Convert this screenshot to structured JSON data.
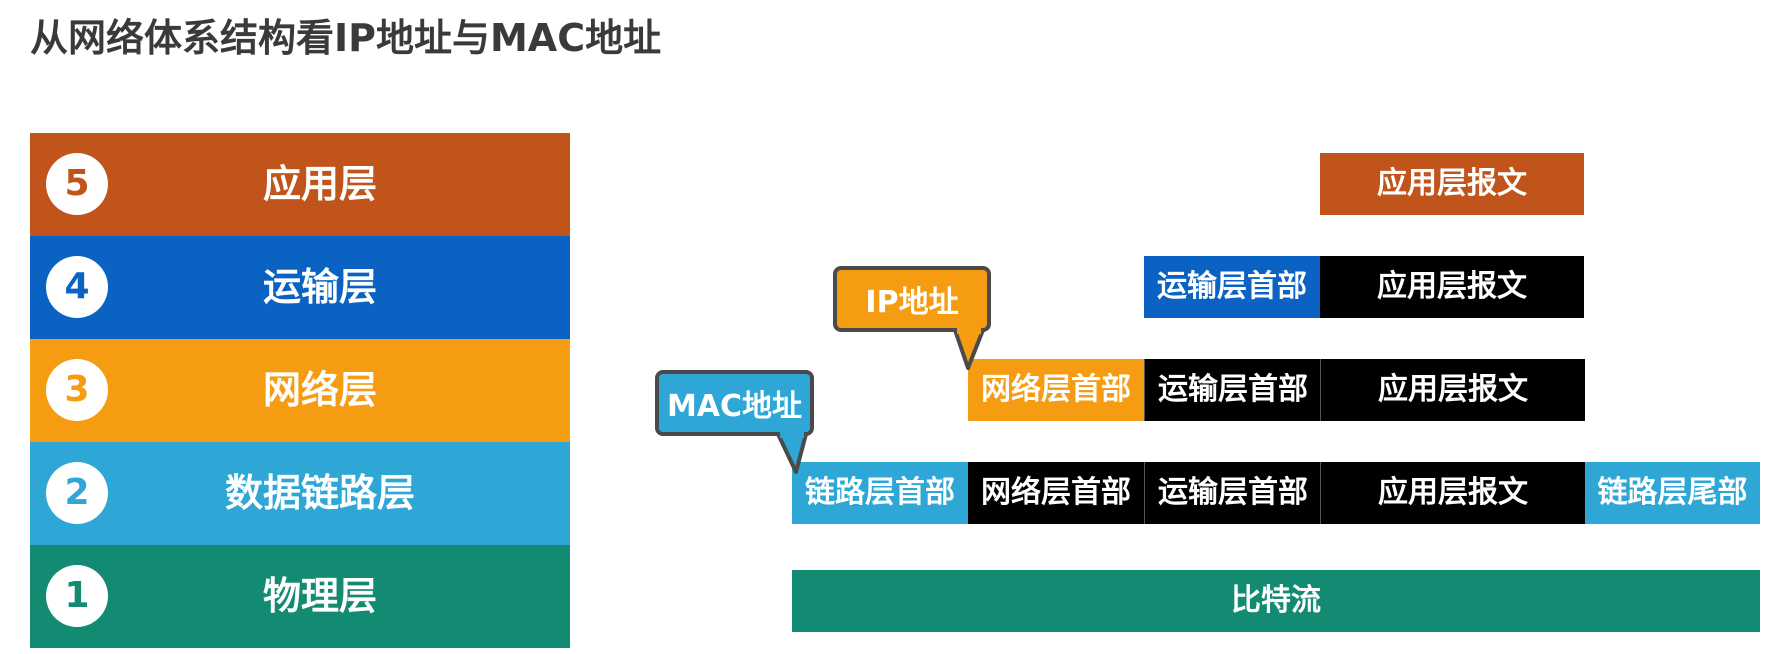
{
  "title": "从网络体系结构看IP地址与MAC地址",
  "layers": [
    {
      "number": "5",
      "name": "应用层",
      "color": "#c0541a"
    },
    {
      "number": "4",
      "name": "运输层",
      "color": "#0a63c2"
    },
    {
      "number": "3",
      "name": "网络层",
      "color": "#f59c12"
    },
    {
      "number": "2",
      "name": "数据链路层",
      "color": "#2ea7d6"
    },
    {
      "number": "1",
      "name": "物理层",
      "color": "#138a72"
    }
  ],
  "pdu": {
    "app_message": "应用层报文",
    "transport_header": "运输层首部",
    "network_header": "网络层首部",
    "link_header": "链路层首部",
    "link_trailer": "链路层尾部",
    "bitstream": "比特流"
  },
  "callouts": {
    "ip_address": "IP地址",
    "mac_address": "MAC地址"
  },
  "colors": {
    "application": "#c0541a",
    "transport": "#0a63c2",
    "network": "#f59c12",
    "datalink": "#2ea7d6",
    "physical": "#138a72",
    "payload": "#000000",
    "callout_border": "#4a4a4a"
  }
}
